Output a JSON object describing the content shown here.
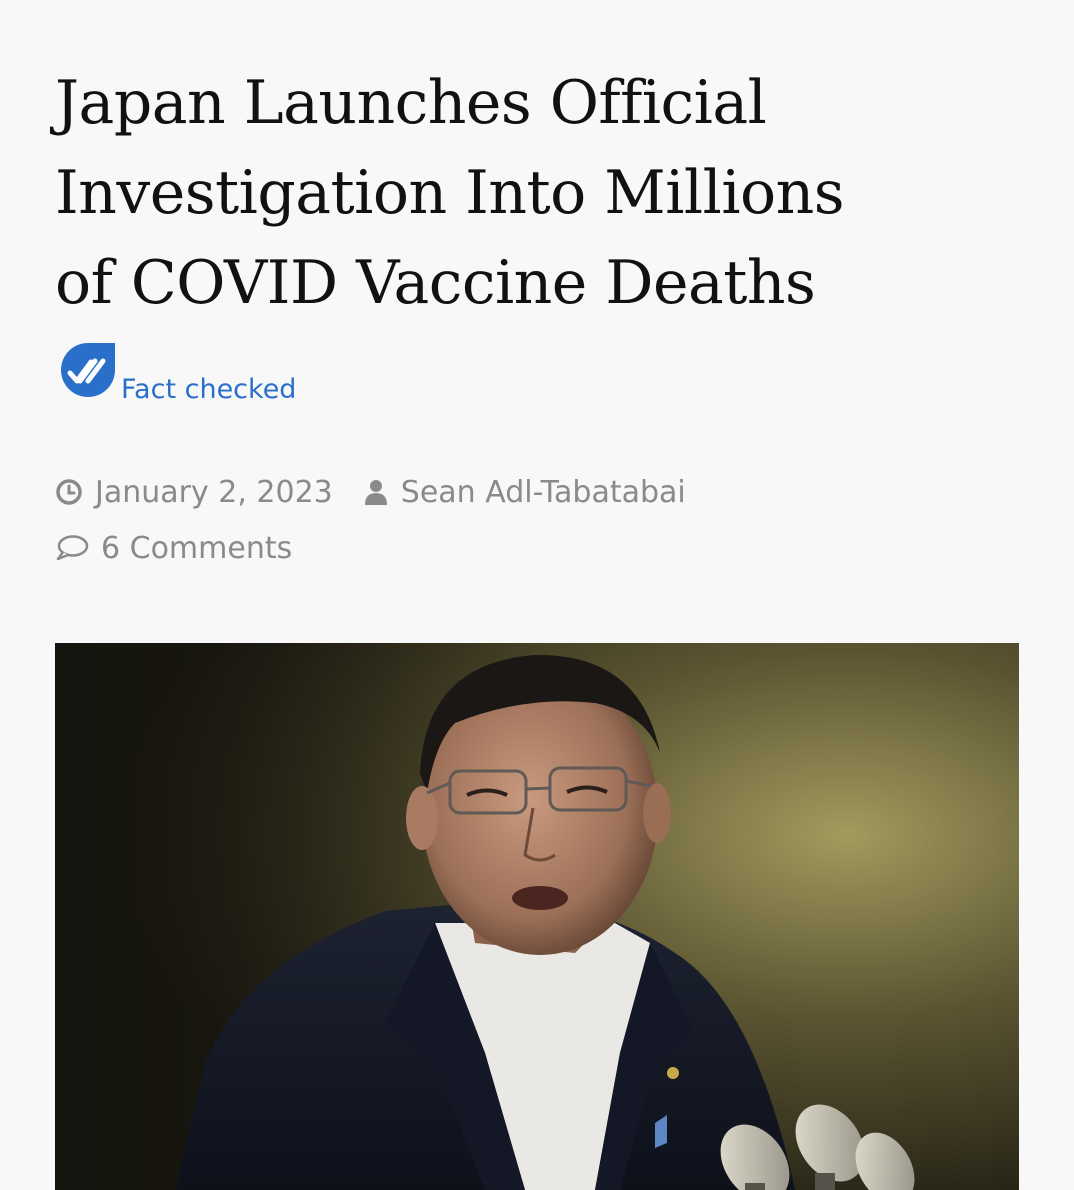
{
  "article": {
    "headline_lines": [
      "Japan Launches Official",
      "Investigation Into Millions",
      "of COVID Vaccine Deaths"
    ],
    "fact_check": {
      "label": "Fact checked",
      "icon": "double-check-badge-icon",
      "color": "#2a6fc9"
    },
    "meta": {
      "date": "January 2, 2023",
      "date_icon": "clock-icon",
      "author": "Sean Adl-Tabatabai",
      "author_icon": "user-icon",
      "comments": "6 Comments",
      "comments_icon": "comment-bubble-icon"
    },
    "hero_image": {
      "subject": "man in dark suit with glasses speaking into microphones"
    }
  }
}
